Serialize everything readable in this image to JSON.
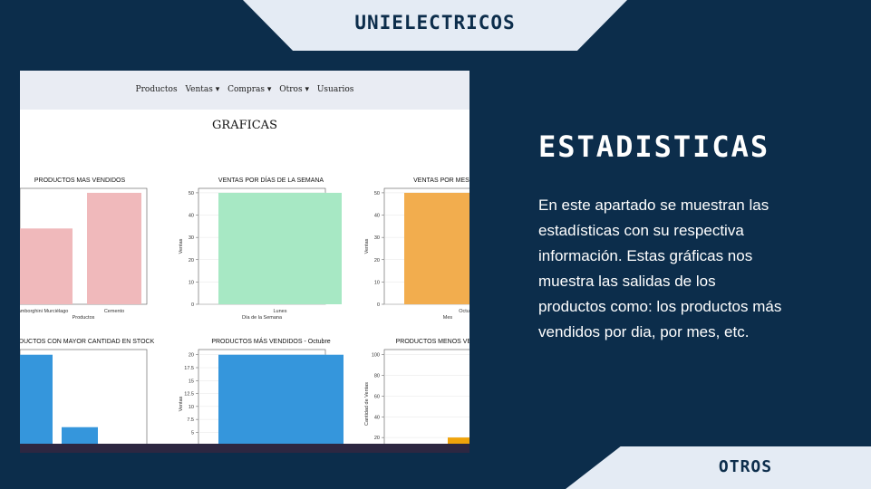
{
  "top_banner": {
    "title": "UNIELECTRICOS"
  },
  "bottom_banner": {
    "title": "OTROS"
  },
  "content": {
    "title": "ESTADISTICAS",
    "description": "En este apartado se muestran las estadísticas con su respectiva información. Estas gráficas nos muestra las salidas de los productos como:  los productos más vendidos por dia, por mes, etc."
  },
  "screenshot": {
    "nav": [
      "Productos",
      "Ventas ▾",
      "Compras ▾",
      "Otros ▾",
      "Usuarios"
    ],
    "page_title": "GRAFICAS",
    "colors": {
      "pink": "#f0b9bb",
      "green": "#a7e8c4",
      "orange": "#f2ad4e",
      "blue": "#3596dc",
      "taskbar": "#2d2741"
    }
  },
  "chart_data": [
    {
      "type": "bar",
      "title": "PRODUCTOS MAS VENDIDOS",
      "categories": [
        "Lamborghini Murciélago",
        "Cemento"
      ],
      "values": [
        34,
        50
      ],
      "xlabel": "Productos",
      "ylabel": "",
      "ylim": [
        0,
        52
      ],
      "color": "#f0b9bb"
    },
    {
      "type": "bar",
      "title": "VENTAS POR DÍAS DE LA SEMANA",
      "categories": [
        "Lunes"
      ],
      "values": [
        50
      ],
      "xlabel": "Día de la Semana",
      "ylabel": "Ventas",
      "ylim": [
        0,
        52
      ],
      "yticks": [
        0,
        10,
        20,
        30,
        40,
        50
      ],
      "color": "#a7e8c4"
    },
    {
      "type": "bar",
      "title": "VENTAS POR MES",
      "categories": [
        "Octubre"
      ],
      "values": [
        50
      ],
      "xlabel": "Mes",
      "ylabel": "Ventas",
      "ylim": [
        0,
        52
      ],
      "yticks": [
        0,
        10,
        20,
        30,
        40,
        50
      ],
      "color": "#f2ad4e"
    },
    {
      "type": "bar",
      "title": "PRODUCTOS CON MAYOR CANTIDAD EN STOCK",
      "categories": [
        "",
        ""
      ],
      "values": [
        100,
        30
      ],
      "ylim": [
        0,
        105
      ],
      "color": "#3596dc"
    },
    {
      "type": "bar",
      "title": "PRODUCTOS MÁS VENDIDOS - Octubre",
      "categories": [
        ""
      ],
      "values": [
        20
      ],
      "ylabel": "Ventas",
      "ylim": [
        0,
        21
      ],
      "yticks": [
        5.0,
        7.5,
        10.0,
        12.5,
        15.0,
        17.5,
        20.0
      ],
      "color": "#3596dc"
    },
    {
      "type": "bar",
      "title": "PRODUCTOS MENOS VENDIDOS",
      "categories": [
        ""
      ],
      "values": [
        20
      ],
      "ylabel": "Cantidad de Ventas",
      "ylim": [
        0,
        105
      ],
      "yticks": [
        20,
        40,
        60,
        80,
        100
      ],
      "color": "#f0a30a"
    }
  ]
}
